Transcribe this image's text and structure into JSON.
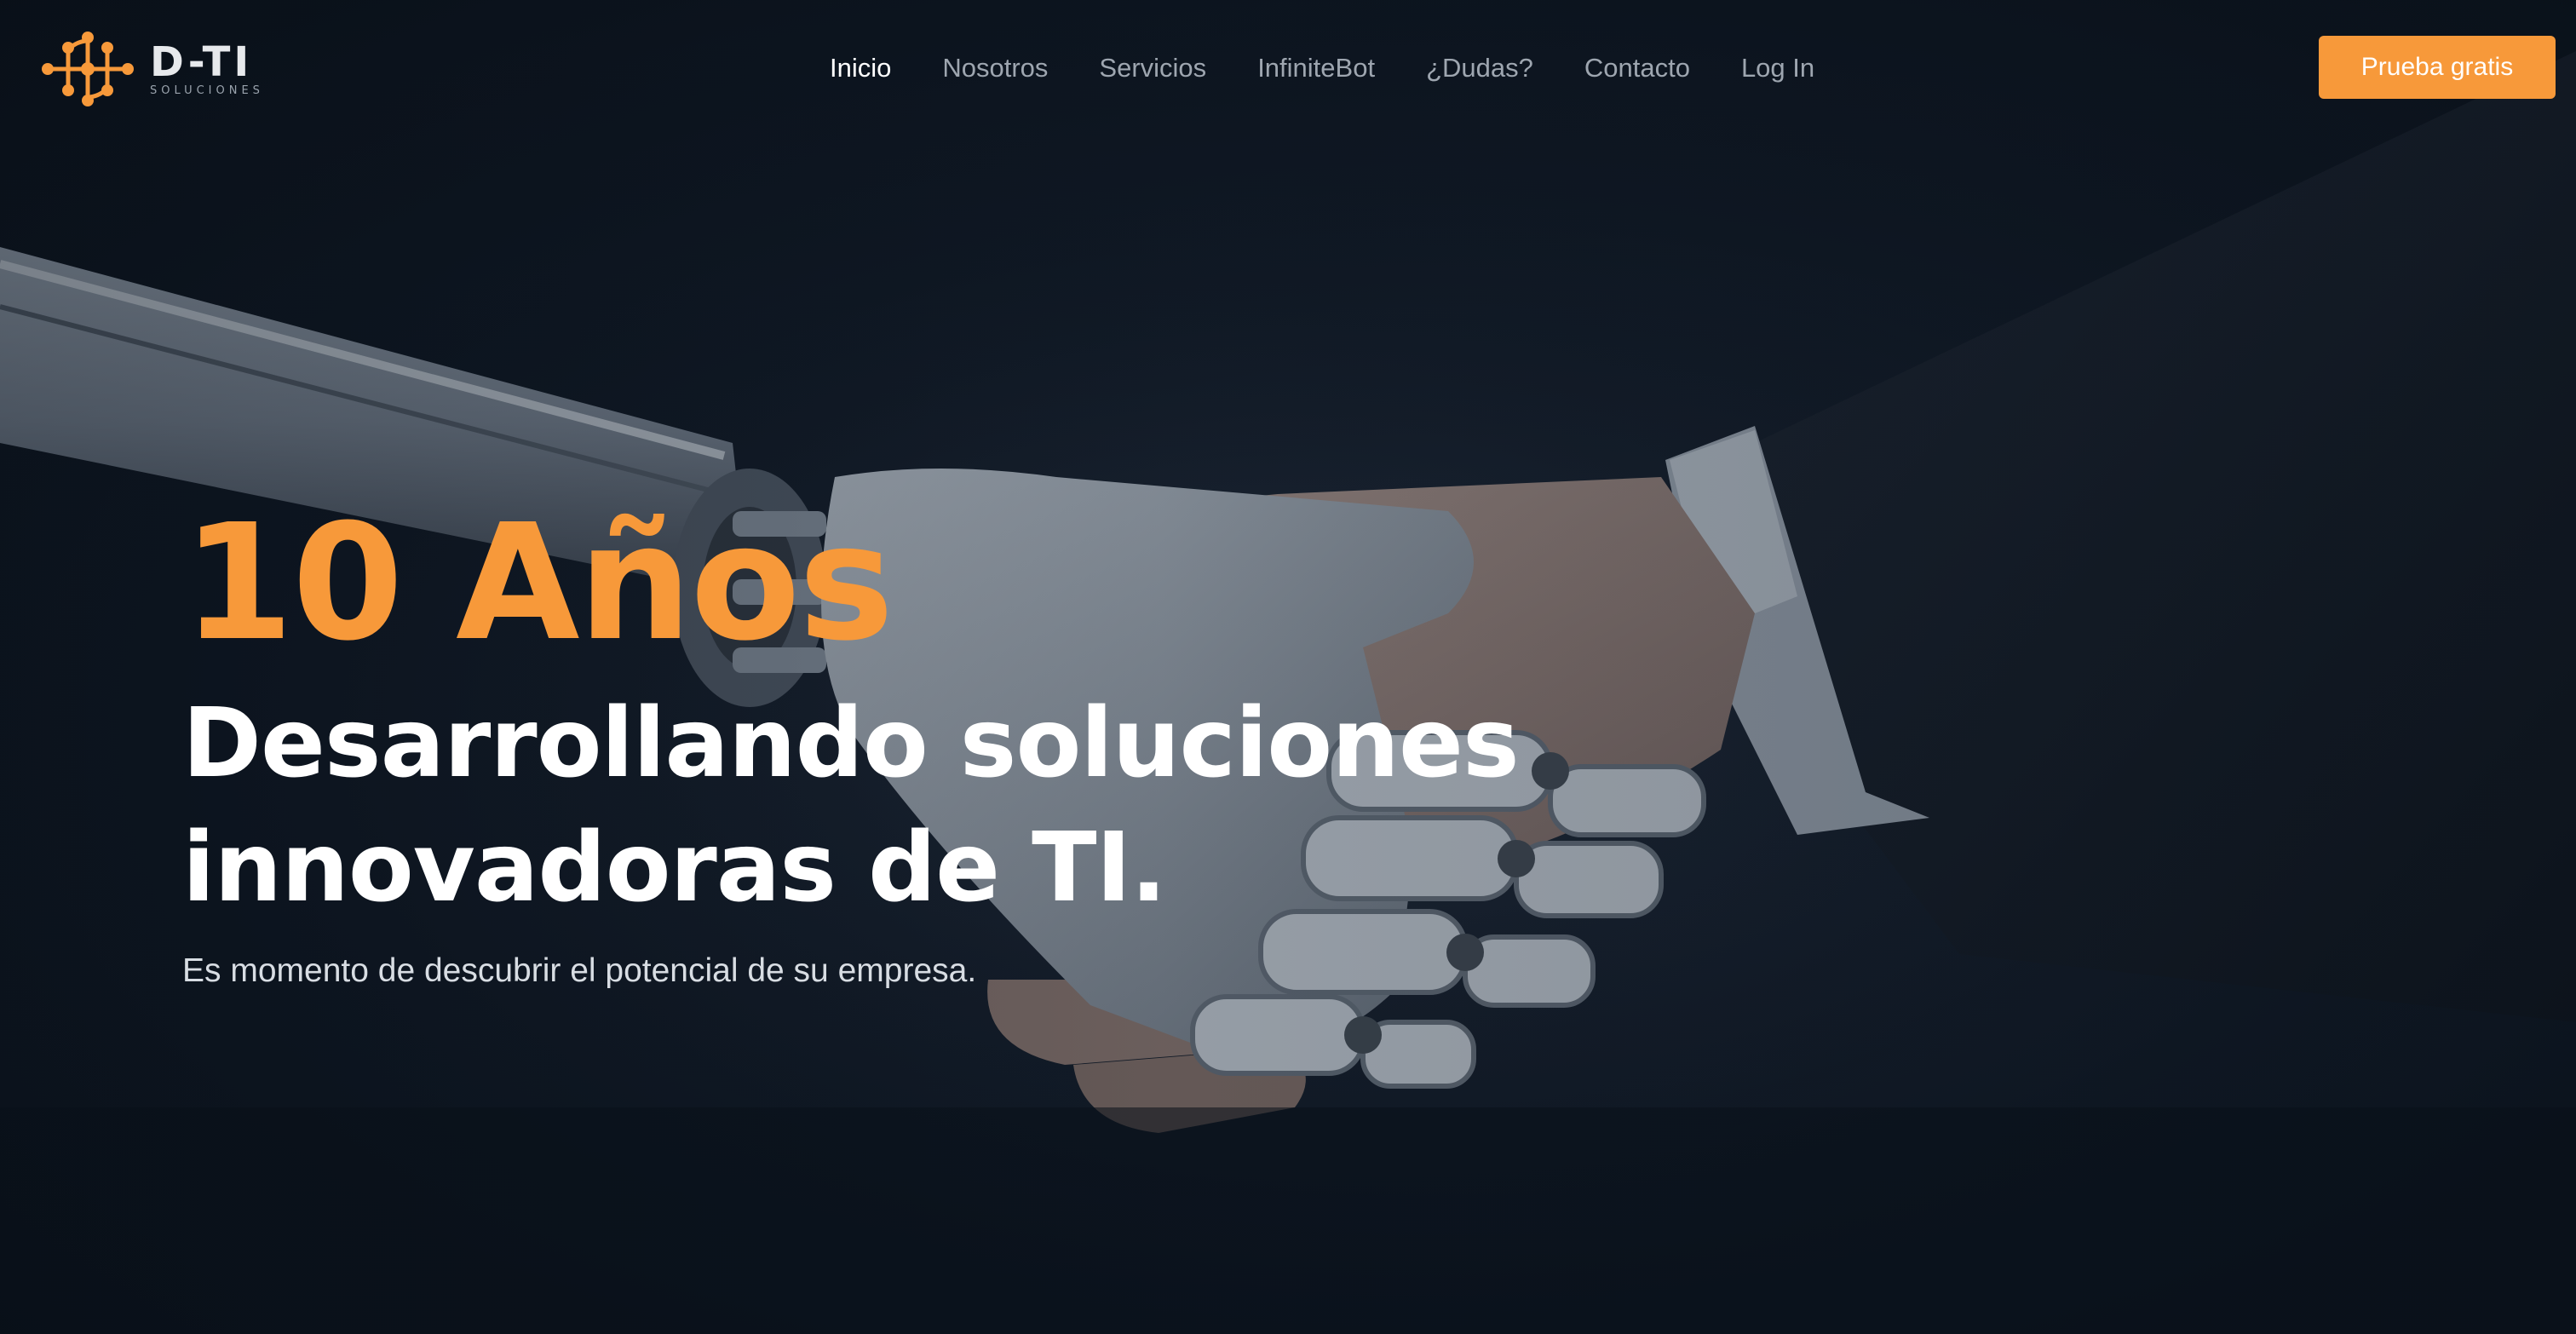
{
  "brand": {
    "name": "D-TI",
    "tagline": "SOLUCIONES",
    "accent_color": "#f7993a",
    "logo_icon": "circuit-dots-icon"
  },
  "nav": {
    "items": [
      {
        "label": "Inicio",
        "active": true
      },
      {
        "label": "Nosotros",
        "active": false
      },
      {
        "label": "Servicios",
        "active": false
      },
      {
        "label": "InfiniteBot",
        "active": false
      },
      {
        "label": "¿Dudas?",
        "active": false
      },
      {
        "label": "Contacto",
        "active": false
      },
      {
        "label": "Log In",
        "active": false
      }
    ],
    "cta_label": "Prueba gratis"
  },
  "hero": {
    "years": "10 Años",
    "title_line1": "Desarrollando soluciones",
    "title_line2": "innovadoras de TI.",
    "subtitle": "Es momento de descubrir el potencial de su empresa.",
    "image_subject": "robot-human-handshake"
  }
}
